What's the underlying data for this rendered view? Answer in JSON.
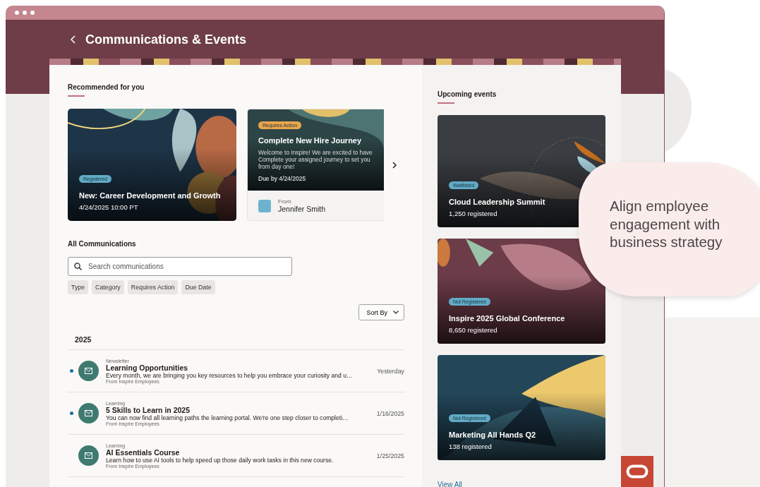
{
  "window": {
    "title": "Communications & Events"
  },
  "recommended": {
    "heading": "Recommended for you",
    "cards": [
      {
        "kind": "event",
        "badge": {
          "label": "Registered",
          "kind": "info"
        },
        "title": "New: Career Development and Growth",
        "subtitle": "4/24/2025 10:00 PT"
      },
      {
        "kind": "journey",
        "badge": {
          "label": "Requires Action",
          "kind": "warning"
        },
        "title": "Complete New Hire Journey",
        "description": [
          "Welcome to Inspire! We are excited to have",
          "Complete your assigned journey to set you",
          "from day one!"
        ],
        "due": "Due by 4/24/2025",
        "from_label": "From",
        "from_name": "Jennifer Smith"
      }
    ]
  },
  "communications": {
    "heading": "All Communications",
    "search": {
      "placeholder": "Search communications"
    },
    "filters": [
      "Type",
      "Category",
      "Requires Action",
      "Due Date"
    ],
    "sort": "Sort By",
    "year": "2025",
    "rows": [
      {
        "unread": true,
        "type": "Newsletter",
        "title": "Learning Opportunities",
        "description": "Every month, we are bringing you key resources to help you embrace your curiosity and u…",
        "from": "From Inspire Employees",
        "date": "Yesterday"
      },
      {
        "unread": true,
        "type": "Learning",
        "title": "5 Skills to Learn in 2025",
        "description": "You can now find all learning paths the learning portal. We're one step closer to completi…",
        "from": "From Inspire Employees",
        "date": "1/16/2025"
      },
      {
        "unread": false,
        "type": "Learning",
        "title": "AI Essentials Course",
        "description": "Learn how to use AI tools to help speed up those daily work tasks in this new course.",
        "from": "From Inspire Employees",
        "date": "1/25/2025"
      }
    ]
  },
  "upcoming": {
    "heading": "Upcoming events",
    "events": [
      {
        "badge": {
          "label": "Waitlisted",
          "kind": "info"
        },
        "title": "Cloud Leadership Summit",
        "count": "1,250 registered"
      },
      {
        "badge": {
          "label": "Not Registered",
          "kind": "info"
        },
        "title": "Inspire 2025 Global Conference",
        "count": "8,650 registered"
      },
      {
        "badge": {
          "label": "Not Registered",
          "kind": "info"
        },
        "title": "Marketing All Hands Q2",
        "count": "138 registered"
      }
    ],
    "view_all": "View All"
  },
  "callout": {
    "text": "Align employee engagement with business strategy"
  }
}
